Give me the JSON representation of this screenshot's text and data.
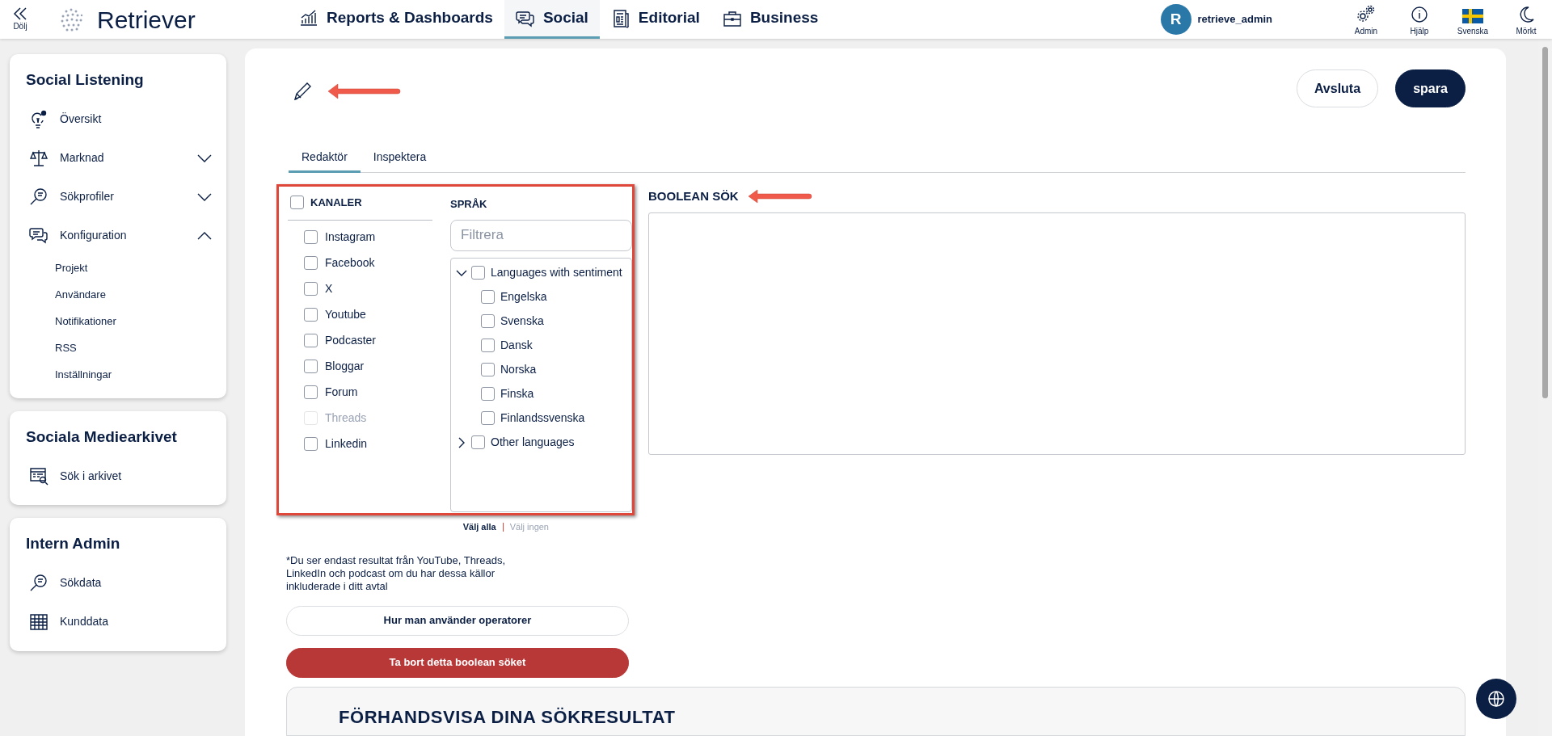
{
  "topbar": {
    "collapse_label": "Dölj",
    "logo": "Retriever",
    "nav": [
      {
        "label": "Reports & Dashboards",
        "selected": false
      },
      {
        "label": "Social",
        "selected": true
      },
      {
        "label": "Editorial",
        "selected": false
      },
      {
        "label": "Business",
        "selected": false
      }
    ],
    "user": {
      "initial": "R",
      "name": "retrieve_admin"
    },
    "tools": [
      {
        "label": "Admin"
      },
      {
        "label": "Hjälp"
      },
      {
        "label": "Svenska"
      },
      {
        "label": "Mörkt"
      }
    ]
  },
  "sidebar": [
    {
      "title": "Social Listening",
      "items": [
        {
          "label": "Översikt",
          "kind": "link"
        },
        {
          "label": "Marknad",
          "kind": "group",
          "expanded": false
        },
        {
          "label": "Sökprofiler",
          "kind": "group",
          "expanded": false
        },
        {
          "label": "Konfiguration",
          "kind": "group",
          "expanded": true,
          "children": [
            {
              "label": "Projekt"
            },
            {
              "label": "Användare"
            },
            {
              "label": "Notifikationer"
            },
            {
              "label": "RSS"
            },
            {
              "label": "Inställningar"
            }
          ]
        }
      ]
    },
    {
      "title": "Sociala Mediearkivet",
      "items": [
        {
          "label": "Sök i arkivet",
          "kind": "link"
        }
      ]
    },
    {
      "title": "Intern Admin",
      "items": [
        {
          "label": "Sökdata",
          "kind": "link"
        },
        {
          "label": "Kunddata",
          "kind": "link"
        }
      ]
    }
  ],
  "editor": {
    "actions": [
      {
        "label": "Avsluta",
        "kind": "secondary"
      },
      {
        "label": "spara",
        "kind": "primary"
      }
    ],
    "tabs": [
      {
        "label": "Redaktör",
        "selected": true
      },
      {
        "label": "Inspektera",
        "selected": false
      }
    ],
    "channels": {
      "title": "KANALER",
      "checked": false,
      "items": [
        {
          "label": "Instagram",
          "checked": false,
          "disabled": false
        },
        {
          "label": "Facebook",
          "checked": false,
          "disabled": false
        },
        {
          "label": "X",
          "checked": false,
          "disabled": false
        },
        {
          "label": "Youtube",
          "checked": false,
          "disabled": false
        },
        {
          "label": "Podcaster",
          "checked": false,
          "disabled": false
        },
        {
          "label": "Bloggar",
          "checked": false,
          "disabled": false
        },
        {
          "label": "Forum",
          "checked": false,
          "disabled": false
        },
        {
          "label": "Threads",
          "checked": false,
          "disabled": true
        },
        {
          "label": "Linkedin",
          "checked": false,
          "disabled": false
        }
      ]
    },
    "languages": {
      "title": "SPRÅK",
      "filter": {
        "placeholder": "Filtrera"
      },
      "tree": [
        {
          "label": "Languages with sentiment",
          "checked": false,
          "expanded": true,
          "children": [
            {
              "label": "Engelska",
              "checked": false
            },
            {
              "label": "Svenska",
              "checked": false
            },
            {
              "label": "Dansk",
              "checked": false
            },
            {
              "label": "Norska",
              "checked": false
            },
            {
              "label": "Finska",
              "checked": false
            },
            {
              "label": "Finlandssvenska",
              "checked": false
            }
          ]
        },
        {
          "label": "Other languages",
          "checked": false,
          "expanded": false
        }
      ]
    },
    "select_all": "Välj alla",
    "select_none": "Välj ingen",
    "boolean_title": "BOOLEAN SÖK",
    "note": "*Du ser endast resultat från YouTube, Threads, LinkedIn och podcast om du har dessa källor inkluderade i ditt avtal",
    "buttons": [
      {
        "label": "Hur man använder operatorer",
        "kind": "secondary"
      },
      {
        "label": "Ta bort detta boolean söket",
        "kind": "danger"
      }
    ],
    "preview_title": "FÖRHANDSVISA DINA SÖKRESULTAT"
  }
}
